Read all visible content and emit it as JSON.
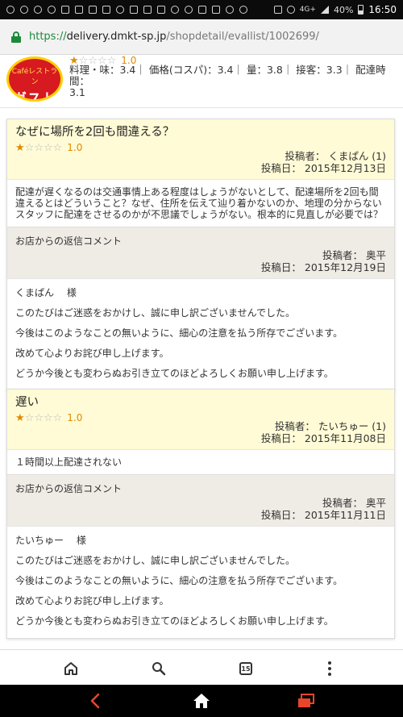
{
  "status_bar": {
    "network": "4G+",
    "battery": "40%",
    "time": "16:50"
  },
  "url_bar": {
    "scheme": "https://",
    "host": "delivery.dmkt-sp.jp",
    "path": "/shopdetail/evallist/1002699/"
  },
  "shop": {
    "logo_top": "Caféレストラン",
    "logo_name": "ガスト",
    "rating": 1,
    "rating_label": "1.0",
    "stats_line1": "料理・味：3.4｜ 価格(コスパ)：3.4｜ 量：3.8｜ 接客：3.3｜ 配達時間：",
    "stats_line2": "3.1"
  },
  "reviews": [
    {
      "title": "なぜに場所を2回も間違える？",
      "rating": 1,
      "rating_label": "1.0",
      "poster": "投稿者： くまぱん (1)",
      "date": "投稿日： 2015年12月13日",
      "body": "配達が遅くなるのは交通事情上ある程度はしょうがないとして、配達場所を2回も間違えるとはどういうこと？なぜ、住所を伝えて辿り着かないのか、地理の分からないスタッフに配達をさせるのかが不思議でしょうがない。根本的に見直しが必要では？",
      "reply_label": "お店からの返信コメント",
      "reply_poster": "投稿者： 奥平",
      "reply_date": "投稿日： 2015年12月19日",
      "reply_lines": [
        "くまぱん　 様",
        "このたびはご迷惑をおかけし、誠に申し訳ございませんでした。",
        "今後はこのようなことの無いように、細心の注意を払う所存でございます。",
        "改めて心よりお詫び申し上げます。",
        "どうか今後とも変わらぬお引き立てのほどよろしくお願い申し上げます。"
      ]
    },
    {
      "title": "遅い",
      "rating": 1,
      "rating_label": "1.0",
      "poster": "投稿者： たいちゅー (1)",
      "date": "投稿日： 2015年11月08日",
      "body": "１時間以上配達されない",
      "reply_label": "お店からの返信コメント",
      "reply_poster": "投稿者： 奥平",
      "reply_date": "投稿日： 2015年11月11日",
      "reply_lines": [
        "たいちゅー　 様",
        "このたびはご迷惑をおかけし、誠に申し訳ございませんでした。",
        "今後はこのようなことの無いように、細心の注意を払う所存でございます。",
        "改めて心よりお詫び申し上げます。",
        "どうか今後とも変わらぬお引き立てのほどよろしくお願い申し上げます。"
      ]
    }
  ],
  "browser_bar": {
    "tab_count": "15"
  },
  "icons": {
    "home": "home-icon",
    "search": "search-icon",
    "tabs": "tabs-icon",
    "menu": "more-menu-icon",
    "back": "back-icon",
    "android_home": "android-home-icon",
    "recents": "recent-apps-icon"
  },
  "colors": {
    "star_on": "#e08a00",
    "card_header": "#fffbd6",
    "reply_header": "#efebe5",
    "logo_red": "#d71920",
    "secure_green": "#1b8a3a",
    "nav_accent": "#e8462a"
  }
}
